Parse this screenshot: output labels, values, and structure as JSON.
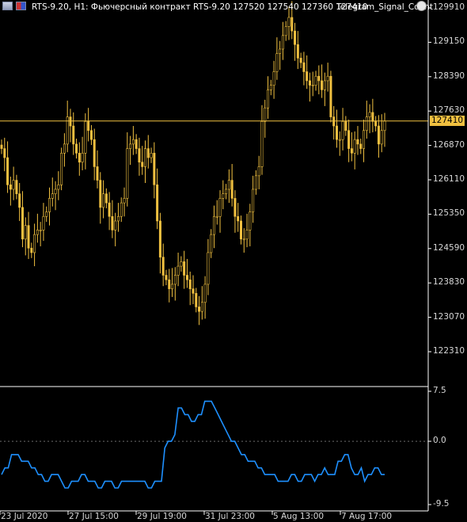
{
  "header": {
    "symbol_info": "RTS-9.20, H1:  Фьючерсный контракт RTS-9.20  127520 127540 127360 127410",
    "indicator_name": "Telegram_Signal_Count",
    "icons": [
      "chart-window-icon",
      "flag-icon",
      "indicator-settings-icon"
    ]
  },
  "price_axis": {
    "labels": [
      "129910",
      "129150",
      "128390",
      "127630",
      "126870",
      "126110",
      "125350",
      "124590",
      "123830",
      "123070",
      "122310"
    ],
    "current_price": "127410"
  },
  "indicator_axis": {
    "labels": [
      "7.5",
      "0.0",
      "-9.5"
    ]
  },
  "time_axis": {
    "labels": [
      "23 Jul 2020",
      "27 Jul 15:00",
      "29 Jul 19:00",
      "31 Jul 23:00",
      "5 Aug 13:00",
      "7 Aug 17:00"
    ]
  },
  "colors": {
    "background": "#000000",
    "candle": "#f0c040",
    "current_price_line": "#f0c040",
    "indicator_line": "#1e90ff",
    "zero_line": "#6e6e6e",
    "separator": "#ffffff"
  },
  "chart_data": {
    "type": "line",
    "price_series": {
      "name": "RTS-9.20",
      "ylim": [
        121900,
        130000
      ],
      "values": [
        126800,
        126600,
        126000,
        125900,
        126100,
        125800,
        125500,
        124800,
        125100,
        124600,
        124500,
        124900,
        125000,
        125000,
        125300,
        125400,
        125700,
        125800,
        125900,
        126000,
        126700,
        126900,
        127500,
        127300,
        126900,
        126700,
        126500,
        126700,
        127400,
        127200,
        127000,
        126400,
        126100,
        125500,
        125800,
        125600,
        125300,
        125000,
        125200,
        125300,
        125600,
        125700,
        126800,
        126900,
        127000,
        126800,
        126500,
        126400,
        126800,
        126600,
        126700,
        126000,
        125200,
        124400,
        124000,
        123900,
        123700,
        123800,
        124000,
        124200,
        124300,
        124000,
        123900,
        123700,
        123600,
        123300,
        123200,
        123400,
        123800,
        124500,
        124900,
        125300,
        125300,
        125700,
        125800,
        125900,
        126100,
        125700,
        125300,
        125200,
        124800,
        124800,
        125000,
        125400,
        125900,
        126200,
        126400,
        127400,
        127700,
        128100,
        128200,
        128500,
        128900,
        129000,
        129300,
        129500,
        129700,
        129400,
        129100,
        128800,
        128700,
        128500,
        128300,
        128200,
        128200,
        128400,
        128300,
        128100,
        128300,
        128400,
        127500,
        127300,
        127000,
        127000,
        127400,
        127200,
        126800,
        126700,
        127000,
        126900,
        126800,
        127200,
        127500,
        127600,
        127400,
        127300,
        126900,
        127200,
        127410
      ]
    },
    "indicator_series": {
      "name": "Telegram_Signal_Count",
      "ylim": [
        -9.5,
        7.5
      ],
      "values": [
        -5,
        -4,
        -4,
        -2,
        -2,
        -2,
        -3,
        -3,
        -3,
        -4,
        -4,
        -5,
        -5,
        -6,
        -6,
        -5,
        -5,
        -5,
        -6,
        -7,
        -7,
        -6,
        -6,
        -6,
        -5,
        -5,
        -6,
        -6,
        -6,
        -7,
        -7,
        -6,
        -6,
        -6,
        -7,
        -7,
        -6,
        -6,
        -6,
        -6,
        -6,
        -6,
        -6,
        -6,
        -7,
        -7,
        -6,
        -6,
        -6,
        -1,
        0,
        0,
        1,
        5,
        5,
        4,
        4,
        3,
        3,
        4,
        4,
        6,
        6,
        6,
        5,
        4,
        3,
        2,
        1,
        0,
        0,
        -1,
        -2,
        -2,
        -3,
        -3,
        -3,
        -4,
        -4,
        -5,
        -5,
        -5,
        -5,
        -6,
        -6,
        -6,
        -6,
        -5,
        -5,
        -6,
        -6,
        -5,
        -5,
        -5,
        -6,
        -5,
        -5,
        -4,
        -5,
        -5,
        -5,
        -3,
        -3,
        -2,
        -2,
        -4,
        -5,
        -5,
        -4,
        -6,
        -5,
        -5,
        -4,
        -4,
        -5,
        -5
      ]
    }
  }
}
